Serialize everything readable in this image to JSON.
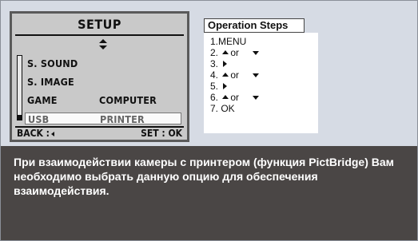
{
  "lcd": {
    "title": "SETUP",
    "menu": {
      "sound": "S. SOUND",
      "image": "S. IMAGE",
      "game": "GAME",
      "computer": "COMPUTER",
      "usb": "USB",
      "printer": "PRINTER"
    },
    "back_label": "BACK :",
    "set_label": "SET : OK"
  },
  "operation": {
    "title": "Operation Steps",
    "steps": {
      "s1": "1.MENU",
      "s2_num": "2.",
      "s2_or": "or",
      "s3_num": "3.",
      "s4_num": "4.",
      "s4_or": "or",
      "s5_num": "5.",
      "s6_num": "6.",
      "s6_or": "or",
      "s7": "7. OK"
    }
  },
  "description": "При взаимодействии камеры с принтером (функция PictBridge) Вам необходимо выбрать данную опцию для обеспечения взаимодействия.",
  "colors": {
    "panel_background": "#d6dbe4",
    "description_background": "#4a4645",
    "lcd_background": "#c9c9c9"
  }
}
